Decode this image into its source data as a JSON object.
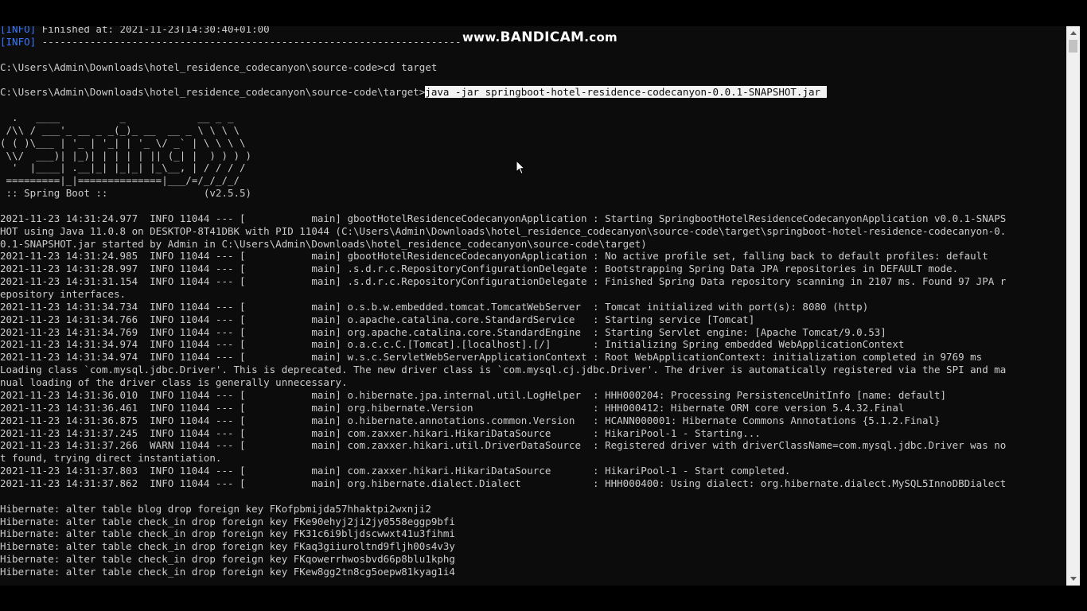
{
  "watermark": {
    "prefix": "www.",
    "brand": "BANDICAM",
    "suffix": ".com"
  },
  "terminal": {
    "lines": [
      {
        "tag": "[INFO]",
        "text": " Finished at: 2021-11-23T14:30:40+01:00"
      },
      {
        "tag": "[INFO]",
        "text": " ------------------------------------------------------------------------"
      },
      {
        "text": ""
      },
      {
        "text": "C:\\Users\\Admin\\Downloads\\hotel_residence_codecanyon\\source-code>cd target"
      },
      {
        "text": ""
      },
      {
        "text": "C:\\Users\\Admin\\Downloads\\hotel_residence_codecanyon\\source-code\\target>",
        "selected": "java -jar springboot-hotel-residence-codecanyon-0.0.1-SNAPSHOT.jar "
      },
      {
        "text": ""
      },
      {
        "text": "  .   ____          _            __ _ _"
      },
      {
        "text": " /\\\\ / ___'_ __ _ _(_)_ __  __ _ \\ \\ \\ \\"
      },
      {
        "text": "( ( )\\___ | '_ | '_| | '_ \\/ _` | \\ \\ \\ \\"
      },
      {
        "text": " \\\\/  ___)| |_)| | | | | || (_| |  ) ) ) )"
      },
      {
        "text": "  '  |____| .__|_| |_|_| |_\\__, | / / / /"
      },
      {
        "text": " =========|_|==============|___/=/_/_/_/"
      },
      {
        "text": " :: Spring Boot ::                (v2.5.5)"
      },
      {
        "text": ""
      },
      {
        "text": "2021-11-23 14:31:24.977  INFO 11044 --- [           main] gbootHotelResidenceCodecanyonApplication : Starting SpringbootHotelResidenceCodecanyonApplication v0.0.1-SNAPS"
      },
      {
        "text": "HOT using Java 11.0.8 on DESKTOP-8T41DBK with PID 11044 (C:\\Users\\Admin\\Downloads\\hotel_residence_codecanyon\\source-code\\target\\springboot-hotel-residence-codecanyon-0."
      },
      {
        "text": "0.1-SNAPSHOT.jar started by Admin in C:\\Users\\Admin\\Downloads\\hotel_residence_codecanyon\\source-code\\target)"
      },
      {
        "text": "2021-11-23 14:31:24.985  INFO 11044 --- [           main] gbootHotelResidenceCodecanyonApplication : No active profile set, falling back to default profiles: default"
      },
      {
        "text": "2021-11-23 14:31:28.997  INFO 11044 --- [           main] .s.d.r.c.RepositoryConfigurationDelegate : Bootstrapping Spring Data JPA repositories in DEFAULT mode."
      },
      {
        "text": "2021-11-23 14:31:31.154  INFO 11044 --- [           main] .s.d.r.c.RepositoryConfigurationDelegate : Finished Spring Data repository scanning in 2107 ms. Found 97 JPA r"
      },
      {
        "text": "epository interfaces."
      },
      {
        "text": "2021-11-23 14:31:34.734  INFO 11044 --- [           main] o.s.b.w.embedded.tomcat.TomcatWebServer  : Tomcat initialized with port(s): 8080 (http)"
      },
      {
        "text": "2021-11-23 14:31:34.766  INFO 11044 --- [           main] o.apache.catalina.core.StandardService   : Starting service [Tomcat]"
      },
      {
        "text": "2021-11-23 14:31:34.769  INFO 11044 --- [           main] org.apache.catalina.core.StandardEngine  : Starting Servlet engine: [Apache Tomcat/9.0.53]"
      },
      {
        "text": "2021-11-23 14:31:34.974  INFO 11044 --- [           main] o.a.c.c.C.[Tomcat].[localhost].[/]       : Initializing Spring embedded WebApplicationContext"
      },
      {
        "text": "2021-11-23 14:31:34.974  INFO 11044 --- [           main] w.s.c.ServletWebServerApplicationContext : Root WebApplicationContext: initialization completed in 9769 ms"
      },
      {
        "text": "Loading class `com.mysql.jdbc.Driver'. This is deprecated. The new driver class is `com.mysql.cj.jdbc.Driver'. The driver is automatically registered via the SPI and ma"
      },
      {
        "text": "nual loading of the driver class is generally unnecessary."
      },
      {
        "text": "2021-11-23 14:31:36.010  INFO 11044 --- [           main] o.hibernate.jpa.internal.util.LogHelper  : HHH000204: Processing PersistenceUnitInfo [name: default]"
      },
      {
        "text": "2021-11-23 14:31:36.461  INFO 11044 --- [           main] org.hibernate.Version                    : HHH000412: Hibernate ORM core version 5.4.32.Final"
      },
      {
        "text": "2021-11-23 14:31:36.875  INFO 11044 --- [           main] o.hibernate.annotations.common.Version   : HCANN000001: Hibernate Commons Annotations {5.1.2.Final}"
      },
      {
        "text": "2021-11-23 14:31:37.245  INFO 11044 --- [           main] com.zaxxer.hikari.HikariDataSource       : HikariPool-1 - Starting..."
      },
      {
        "text": "2021-11-23 14:31:37.266  WARN 11044 --- [           main] com.zaxxer.hikari.util.DriverDataSource  : Registered driver with driverClassName=com.mysql.jdbc.Driver was no"
      },
      {
        "text": "t found, trying direct instantiation."
      },
      {
        "text": "2021-11-23 14:31:37.803  INFO 11044 --- [           main] com.zaxxer.hikari.HikariDataSource       : HikariPool-1 - Start completed."
      },
      {
        "text": "2021-11-23 14:31:37.862  INFO 11044 --- [           main] org.hibernate.dialect.Dialect            : HHH000400: Using dialect: org.hibernate.dialect.MySQL5InnoDBDialect"
      },
      {
        "text": ""
      },
      {
        "text": "Hibernate: alter table blog drop foreign key FKofpbmijda57hhaktpi2wxnji2"
      },
      {
        "text": "Hibernate: alter table check_in drop foreign key FKe90ehyj2ji2jy0558eggp9bfi"
      },
      {
        "text": "Hibernate: alter table check_in drop foreign key FK31c6i9bljdscwwxt41u3fihmi"
      },
      {
        "text": "Hibernate: alter table check_in drop foreign key FKaq3giiuroltnd9fljh00s4v3y"
      },
      {
        "text": "Hibernate: alter table check_in drop foreign key FKqowerrhwosbvd66p8blu1kphg"
      },
      {
        "text": "Hibernate: alter table check_in drop foreign key FKew8gg2tn8cg5oepw81kyag1i4"
      }
    ]
  },
  "colors": {
    "background": "#0c0c0c",
    "foreground": "#cccccc",
    "info_tag": "#3b78ff",
    "selection": "#f2f2f2"
  }
}
